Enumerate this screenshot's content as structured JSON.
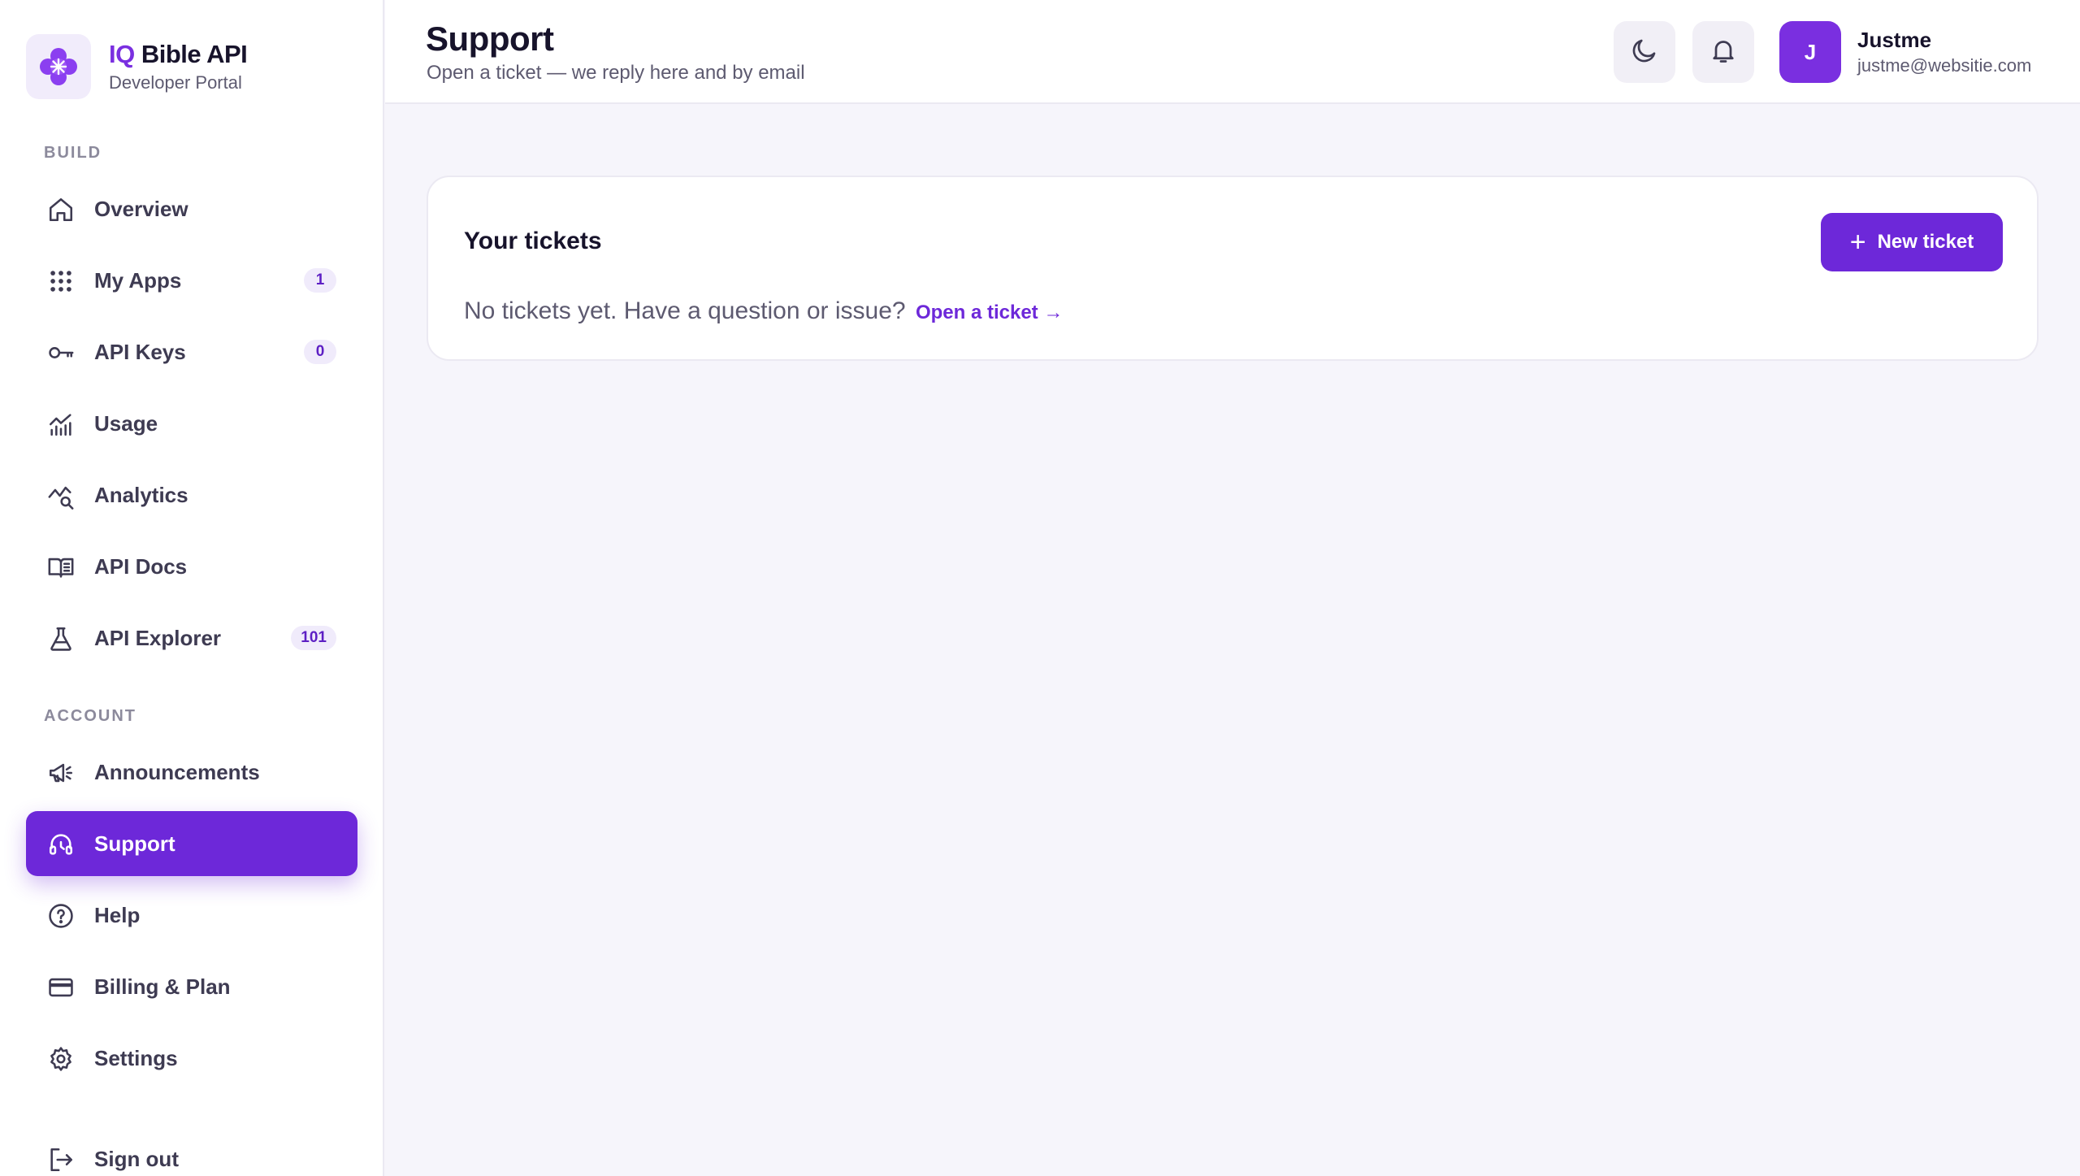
{
  "brand": {
    "title_accent": "IQ",
    "title_rest": " Bible API",
    "subtitle": "Developer Portal"
  },
  "sidebar": {
    "sections": [
      {
        "label": "BUILD",
        "items": [
          {
            "label": "Overview",
            "icon": "home-icon"
          },
          {
            "label": "My Apps",
            "icon": "grid-icon",
            "badge": "1"
          },
          {
            "label": "API Keys",
            "icon": "key-icon",
            "badge": "0"
          },
          {
            "label": "Usage",
            "icon": "chart-icon"
          },
          {
            "label": "Analytics",
            "icon": "analytics-icon"
          },
          {
            "label": "API Docs",
            "icon": "book-icon"
          },
          {
            "label": "API Explorer",
            "icon": "flask-icon",
            "badge": "101"
          }
        ]
      },
      {
        "label": "ACCOUNT",
        "items": [
          {
            "label": "Announcements",
            "icon": "megaphone-icon"
          },
          {
            "label": "Support",
            "icon": "headset-icon",
            "active": true
          },
          {
            "label": "Help",
            "icon": "help-icon"
          },
          {
            "label": "Billing & Plan",
            "icon": "card-icon"
          },
          {
            "label": "Settings",
            "icon": "gear-icon"
          }
        ]
      }
    ],
    "sign_out": "Sign out"
  },
  "header": {
    "title": "Support",
    "subtitle": "Open a ticket — we reply here and by email",
    "user": {
      "initial": "J",
      "name": "Justme",
      "email": "justme@websitie.com"
    }
  },
  "tickets": {
    "title": "Your tickets",
    "new_button": "New ticket",
    "empty_text": "No tickets yet. Have a question or issue?",
    "empty_link": "Open a ticket →"
  },
  "colors": {
    "accent": "#6d28d9",
    "avatar": "#7a2fe0",
    "background": "#f6f5fb"
  }
}
